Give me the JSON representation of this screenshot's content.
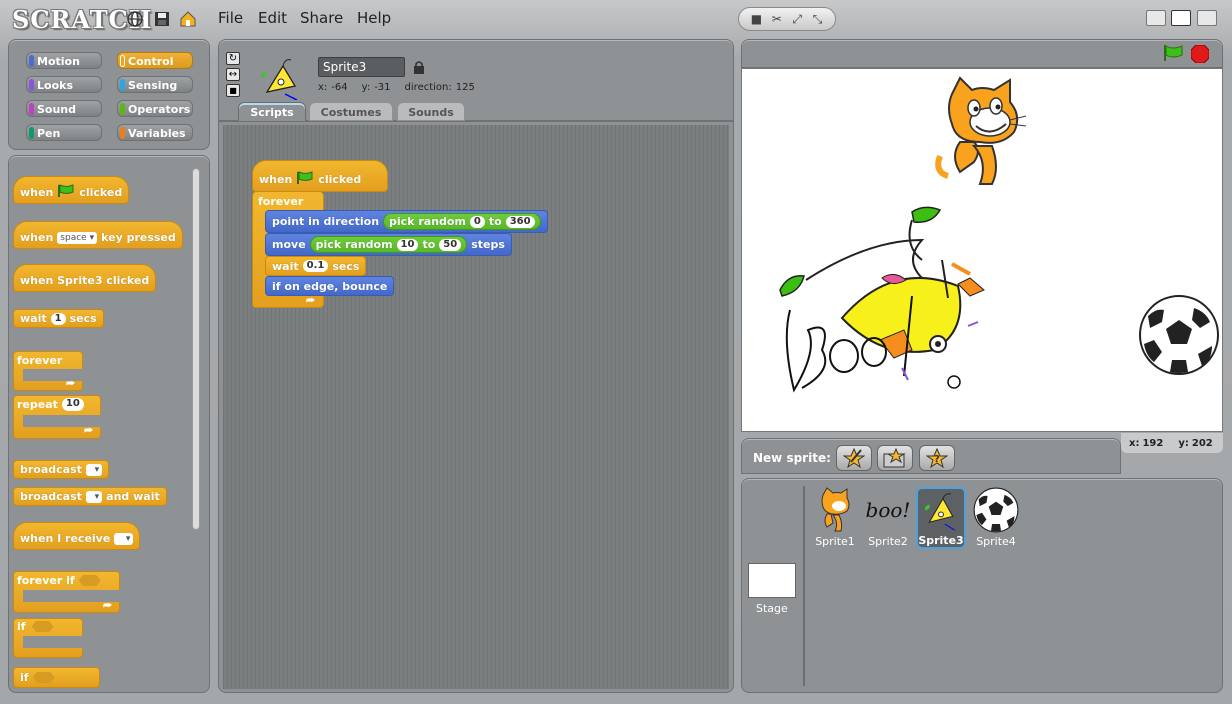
{
  "app": {
    "logo": "SCRATCH"
  },
  "menu": {
    "file": "File",
    "edit": "Edit",
    "share": "Share",
    "help": "Help"
  },
  "categories": {
    "motion": "Motion",
    "control": "Control",
    "looks": "Looks",
    "sensing": "Sensing",
    "sound": "Sound",
    "operators": "Operators",
    "pen": "Pen",
    "variables": "Variables",
    "selected": "Control"
  },
  "palette": {
    "when_flag": [
      "when",
      "clicked"
    ],
    "when_key": [
      "when",
      "space",
      "key pressed"
    ],
    "when_sprite": "when Sprite3 clicked",
    "wait": [
      "wait",
      "1",
      "secs"
    ],
    "forever": "forever",
    "repeat": [
      "repeat",
      "10"
    ],
    "broadcast": "broadcast",
    "broadcast_wait": [
      "broadcast",
      "and wait"
    ],
    "when_receive": "when I receive",
    "forever_if": "forever if",
    "if1": "if",
    "if2": "if"
  },
  "sprite_info": {
    "name": "Sprite3",
    "x_label": "x:",
    "x": "-64",
    "y_label": "y:",
    "y": "-31",
    "dir_label": "direction:",
    "direction": "125"
  },
  "tabs": {
    "scripts": "Scripts",
    "costumes": "Costumes",
    "sounds": "Sounds",
    "active": "Scripts"
  },
  "script": {
    "hat": [
      "when",
      "clicked"
    ],
    "forever": "forever",
    "point": [
      "point in direction",
      "pick random",
      "0",
      "to",
      "360"
    ],
    "move": [
      "move",
      "pick random",
      "10",
      "to",
      "50",
      "steps"
    ],
    "wait": [
      "wait",
      "0.1",
      "secs"
    ],
    "bounce": "if on edge, bounce"
  },
  "stage": {
    "mouse_x_label": "x:",
    "mouse_x": "192",
    "mouse_y_label": "y:",
    "mouse_y": "202",
    "boo_text": "Boo!"
  },
  "sprites": {
    "new_sprite_label": "New sprite:",
    "items": [
      "Sprite1",
      "Sprite2",
      "Sprite3",
      "Sprite4"
    ],
    "selected": "Sprite3",
    "stage_label": "Stage",
    "sprite2_thumb": "boo!"
  },
  "colors": {
    "control": "#e6a822",
    "motion": "#4a6cd4",
    "operators": "#5cb712",
    "looks": "#8a55d7",
    "sound": "#bb42c3",
    "pen": "#0e9a6c",
    "sensing": "#2ca5e2",
    "variables": "#ee7d16"
  }
}
